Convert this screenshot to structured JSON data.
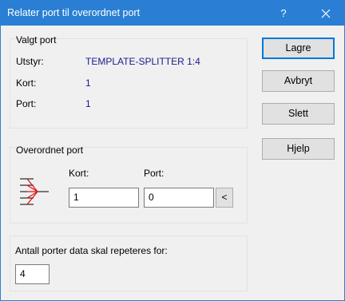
{
  "window": {
    "title": "Relater port til overordnet port"
  },
  "titlebar": {
    "help_label": "?"
  },
  "valgt_port": {
    "title": "Valgt port",
    "rows": [
      {
        "label": "Utstyr:",
        "value": "TEMPLATE-SPLITTER 1:4"
      },
      {
        "label": "Kort:",
        "value": "1"
      },
      {
        "label": "Port:",
        "value": "1"
      }
    ]
  },
  "overordnet_port": {
    "title": "Overordnet port",
    "icon": "splitter-icon",
    "kort_label": "Kort:",
    "kort_value": "1",
    "port_label": "Port:",
    "port_value": "0",
    "pick_button_label": "<"
  },
  "repeat": {
    "label": "Antall porter data skal repeteres for:",
    "value": "4"
  },
  "buttons": {
    "save": "Lagre",
    "cancel": "Avbryt",
    "delete": "Slett",
    "help": "Hjelp"
  },
  "colors": {
    "titlebar": "#2a7fd4",
    "value_text": "#1a1a8c",
    "icon_red": "#e0141e"
  }
}
